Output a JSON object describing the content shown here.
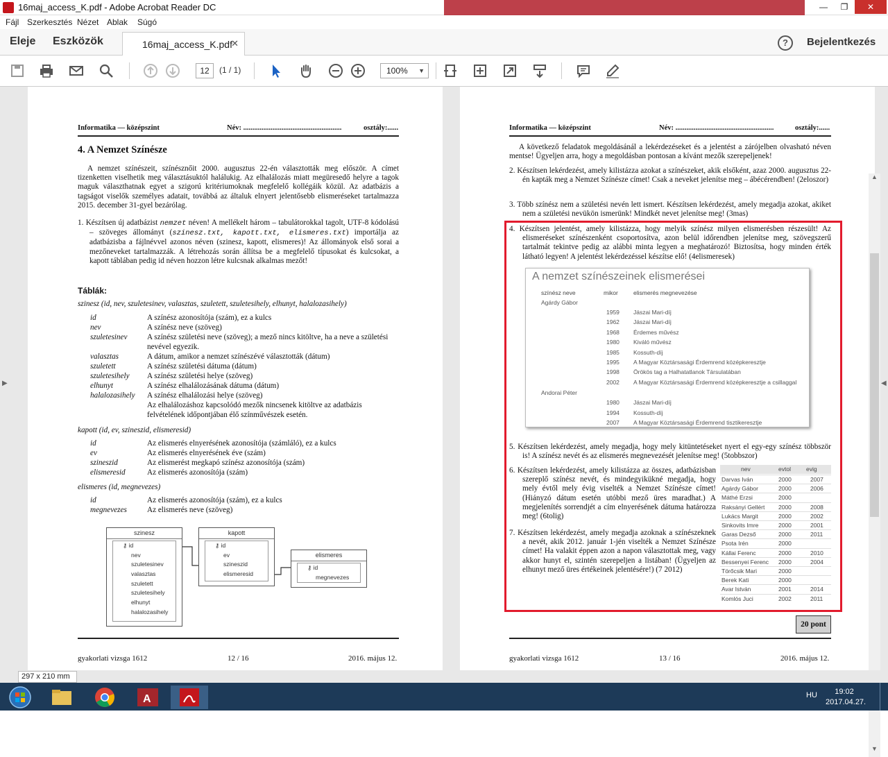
{
  "window": {
    "title": "16maj_access_K.pdf - Adobe Acrobat Reader DC"
  },
  "menu": [
    "Fájl",
    "Szerkesztés",
    "Nézet",
    "Ablak",
    "Súgó"
  ],
  "tabs": {
    "home": "Eleje",
    "tools": "Eszközök",
    "doc": "16maj_access_K.pdf",
    "login": "Bejelentkezés"
  },
  "toolbar": {
    "page": "12",
    "pagecount": "(1 / 1)",
    "zoom": "100%"
  },
  "page1": {
    "header_left": "Informatika — középszint",
    "header_name": "Név: ......................................................",
    "header_class": "osztály:......",
    "title": "4. A Nemzet Színésze",
    "intro": "A nemzet színészeit, színésznőit 2000. augusztus 22-én választották meg először. A címet tizenketten viselhetik meg választásuktól halálukig. Az elhalálozás miatt megüresedő helyre a tagok maguk választhatnak egyet a szigorú kritériumoknak megfelelő kollégáik közül. Az adatbázis a tagságot viselők személyes adatait, továbbá az általuk elnyert jelentősebb elismeréseket tartalmazza 2015. december 31-gyel bezárólag.",
    "task1_a": "1. Készítsen új adatbázist ",
    "task1_mono": "nemzet",
    "task1_b": " néven! A mellékelt három – tabulátorokkal tagolt, UTF-8 kódolású – szöveges állományt (",
    "task1_files": "szinesz.txt, kapott.txt, elismeres.txt",
    "task1_c": ") importálja az adatbázisba a fájlnévvel azonos néven (szinesz, kapott, elismeres)! Az állományok első sorai a mezőneveket tartalmazzák. A létrehozás során állítsa be a megfelelő típusokat és kulcsokat, a kapott táblában pedig id néven hozzon létre kulcsnak alkalmas mezőt!",
    "tables_label": "Táblák:",
    "szinesz_sig": "szinesz (id, nev, szuletesinev, valasztas, szuletett, szuletesihely, elhunyt, halalozasihely)",
    "szinesz_fields": [
      {
        "n": "id",
        "d": "A színész azonosítója (szám), ez a kulcs"
      },
      {
        "n": "nev",
        "d": "A színész neve (szöveg)"
      },
      {
        "n": "szuletesinev",
        "d": "A színész születési neve (szöveg); a mező nincs kitöltve, ha a neve a születési nevével egyezik."
      },
      {
        "n": "valasztas",
        "d": "A dátum, amikor a nemzet színészévé választották (dátum)"
      },
      {
        "n": "szuletett",
        "d": "A színész születési dátuma (dátum)"
      },
      {
        "n": "szuletesihely",
        "d": "A színész születési helye (szöveg)"
      },
      {
        "n": "elhunyt",
        "d": "A színész elhalálozásának dátuma (dátum)"
      },
      {
        "n": "halalozasihely",
        "d": "A színész elhalálozási helye (szöveg)"
      }
    ],
    "szinesz_note": "Az elhalálozáshoz kapcsolódó mezők nincsenek kitöltve az adatbázis felvételének időpontjában élő színművészek esetén.",
    "kapott_sig": "kapott (id, ev, szineszid, elismeresid)",
    "kapott_fields": [
      {
        "n": "id",
        "d": "Az elismerés elnyerésének azonosítója (számláló), ez a kulcs"
      },
      {
        "n": "ev",
        "d": "Az elismerés elnyerésének éve (szám)"
      },
      {
        "n": "szineszid",
        "d": "Az elismerést megkapó színész azonosítója (szám)"
      },
      {
        "n": "elismeresid",
        "d": "Az elismerés azonosítója (szám)"
      }
    ],
    "elismeres_sig": "elismeres (id, megnevezes)",
    "elismeres_fields": [
      {
        "n": "id",
        "d": "Az elismerés azonosítója (szám), ez a kulcs"
      },
      {
        "n": "megnevezes",
        "d": "Az elismerés neve (szöveg)"
      }
    ],
    "er": {
      "szinesz": {
        "title": "szinesz",
        "fields": [
          "id",
          "nev",
          "szuletesinev",
          "valasztas",
          "szuletett",
          "szuletesihely",
          "elhunyt",
          "halalozasihely"
        ]
      },
      "kapott": {
        "title": "kapott",
        "fields": [
          "id",
          "ev",
          "szineszid",
          "elismeresid"
        ]
      },
      "elismeres": {
        "title": "elismeres",
        "fields": [
          "id",
          "megnevezes"
        ]
      }
    },
    "footer_left": "gyakorlati vizsga 1612",
    "footer_mid": "12 / 16",
    "footer_right": "2016. május 12."
  },
  "page2": {
    "header_left": "Informatika — középszint",
    "header_name": "Név: ......................................................",
    "header_class": "osztály:......",
    "lead": "A következő feladatok megoldásánál a lekérdezéseket és a jelentést a zárójelben olvasható néven mentse! Ügyeljen arra, hogy a megoldásban pontosan a kívánt mezők szerepeljenek!",
    "t2": "2. Készítsen lekérdezést, amely kilistázza azokat a színészeket, akik elsőként, azaz 2000. augusztus 22-én kapták meg a Nemzet Színésze címet! Csak a neveket jelenítse meg – ábécérendben! (2eloszor)",
    "t3": "3. Több színész nem a születési nevén lett ismert. Készítsen lekérdezést, amely megadja azokat, akiket nem a születési nevükön ismerünk! Mindkét nevet jelenítse meg! (3mas)",
    "t4": "4. Készítsen jelentést, amely kilistázza, hogy melyik színész milyen elismerésben részesült! Az elismeréseket színészenként csoportosítva, azon belül időrendben jelenítse meg, szövegszerű tartalmát tekintve pedig az alábbi minta legyen a meghatározó! Biztosítsa, hogy minden érték látható legyen! A jelentést lekérdezéssel készítse elő! (4elismeresek)",
    "report": {
      "title": "A nemzet színészeinek elismerései",
      "cols": [
        "színész neve",
        "mikor",
        "elismerés megnevezése"
      ],
      "groups": [
        {
          "name": "Agárdy Gábor",
          "rows": [
            [
              "1959",
              "Jászai Mari-díj"
            ],
            [
              "1962",
              "Jászai Mari-díj"
            ],
            [
              "1968",
              "Érdemes művész"
            ],
            [
              "1980",
              "Kiváló művész"
            ],
            [
              "1985",
              "Kossuth-díj"
            ],
            [
              "1995",
              "A Magyar Köztársasági Érdemrend középkeresztje"
            ],
            [
              "1998",
              "Örökös tag a Halhatatlanok Társulatában"
            ],
            [
              "2002",
              "A Magyar Köztársasági Érdemrend középkeresztje a csillaggal"
            ]
          ]
        },
        {
          "name": "Andorai Péter",
          "rows": [
            [
              "1980",
              "Jászai Mari-díj"
            ],
            [
              "1994",
              "Kossuth-díj"
            ],
            [
              "2007",
              "A Magyar Köztársasági Érdemrend tisztikeresztje"
            ]
          ]
        }
      ]
    },
    "t5": "5. Készítsen lekérdezést, amely megadja, hogy mely kitüntetéseket nyert el egy-egy színész többször is! A színész nevét és az elismerés megnevezését jelenítse meg! (5tobbszor)",
    "t6": "6. Készítsen lekérdezést, amely kilistázza az összes, adatbázisban szereplő színész nevét, és mindegyikükné megadja, hogy mely évtől mely évig viselték a Nemzet Színésze címet! (Hiányzó dátum esetén utóbbi mező üres maradhat.) A megjelenítés sorrendjét a cím elnyerésének dátuma határozza meg! (6tolig)",
    "t7": "7. Készítsen lekérdezést, amely megadja azoknak a színészeknek a nevét, akik 2012. január 1-jén viselték a Nemzet Színésze címet! Ha valakit éppen azon a napon választottak meg, vagy akkor hunyt el, szintén szerepeljen a listában! (Ügyeljen az elhunyt mező üres értékeinek jelentésére!) (7 2012)",
    "qtable": {
      "cols": [
        "nev",
        "evtol",
        "evig"
      ],
      "rows": [
        [
          "Darvas Iván",
          "2000",
          "2007"
        ],
        [
          "Agárdy Gábor",
          "2000",
          "2006"
        ],
        [
          "Máthé Erzsi",
          "2000",
          ""
        ],
        [
          "Raksányi Gellért",
          "2000",
          "2008"
        ],
        [
          "Lukács Margit",
          "2000",
          "2002"
        ],
        [
          "Sinkovits Imre",
          "2000",
          "2001"
        ],
        [
          "Garas Dezső",
          "2000",
          "2011"
        ],
        [
          "Psota Irén",
          "2000",
          ""
        ],
        [
          "Kállai Ferenc",
          "2000",
          "2010"
        ],
        [
          "Bessenyei Ferenc",
          "2000",
          "2004"
        ],
        [
          "Törőcsik Mari",
          "2000",
          ""
        ],
        [
          "Berek Kati",
          "2000",
          ""
        ],
        [
          "Avar István",
          "2001",
          "2014"
        ],
        [
          "Komlós Juci",
          "2002",
          "2011"
        ]
      ]
    },
    "points": "20 pont",
    "footer_left": "gyakorlati vizsga 1612",
    "footer_mid": "13 / 16",
    "footer_right": "2016. május 12."
  },
  "status": {
    "pagesize": "297 x 210 mm"
  },
  "taskbar": {
    "lang": "HU",
    "time": "19:02",
    "date": "2017.04.27."
  },
  "colors": {
    "highlight": "#e21b2d",
    "taskbar": "#1d3a58",
    "close": "#c9302c"
  }
}
